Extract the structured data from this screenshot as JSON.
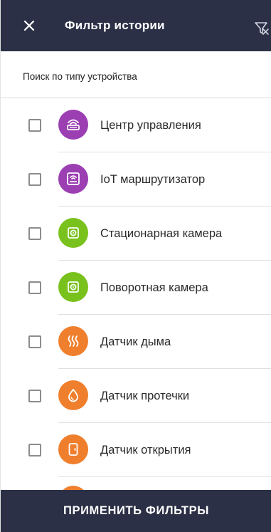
{
  "header": {
    "title": "Фильтр истории",
    "close_icon": "close-icon",
    "reset_icon": "filter-off-icon"
  },
  "subheader": {
    "text": "Поиск по типу устройства"
  },
  "devices": [
    {
      "label": "Центр управления",
      "icon": "router-icon",
      "color": "#9b3fb3",
      "checked": false
    },
    {
      "label": "IoT маршрутизатор",
      "icon": "router-icon",
      "color": "#9b3fb3",
      "checked": false
    },
    {
      "label": "Стационарная камера",
      "icon": "camera-icon",
      "color": "#79c11c",
      "checked": false
    },
    {
      "label": "Поворотная камера",
      "icon": "camera-icon",
      "color": "#79c11c",
      "checked": false
    },
    {
      "label": "Датчик дыма",
      "icon": "smoke-icon",
      "color": "#ef7f2d",
      "checked": false
    },
    {
      "label": "Датчик протечки",
      "icon": "water-drop-icon",
      "color": "#ef7f2d",
      "checked": false
    },
    {
      "label": "Датчик открытия",
      "icon": "door-icon",
      "color": "#ef7f2d",
      "checked": false
    }
  ],
  "apply_button": {
    "label": "ПРИМЕНИТЬ ФИЛЬТРЫ"
  },
  "colors": {
    "header_bg": "#2b3046",
    "purple": "#9b3fb3",
    "green": "#79c11c",
    "orange": "#ef7f2d"
  }
}
